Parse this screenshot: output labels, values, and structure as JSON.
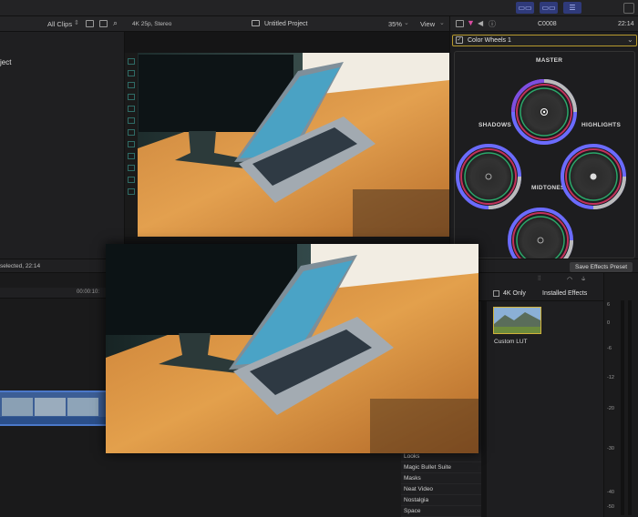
{
  "toolbar": {
    "buttons": [
      "▭▭",
      "▭▭",
      "☰"
    ]
  },
  "browser": {
    "filter_label": "All Clips",
    "partial_item": "ject"
  },
  "viewer": {
    "format": "4K 25p, Stereo",
    "project_title": "Untitled Project",
    "zoom": "35%",
    "view_label": "View"
  },
  "inspector": {
    "clip_name": "C0008",
    "time": "22:14",
    "effect_select": "Color Wheels 1",
    "wheels": {
      "master": "MASTER",
      "shadows": "SHADOWS",
      "highlights": "HIGHLIGHTS",
      "midtones": "MIDTONES"
    }
  },
  "midbar": {
    "selection_status": "selected, 22:14",
    "save_preset": "Save Effects Preset"
  },
  "timeline": {
    "ruler_time": "00:00:10:"
  },
  "effects": {
    "filter_4k": "4K Only",
    "installed": "Installed Effects",
    "lut_label": "Custom LUT",
    "categories": [
      "Looks",
      "Magic Bullet Suite",
      "Masks",
      "Neat Video",
      "Nostalgia",
      "Space"
    ]
  },
  "meters": {
    "ticks": [
      "6",
      "0",
      "-6",
      "-12",
      "-20",
      "-30",
      "-40",
      "-50"
    ]
  },
  "colors": {
    "accent_blue": "#2f3a7a",
    "clip_blue": "#2b4f8a",
    "select_gold": "#b79a2e"
  }
}
